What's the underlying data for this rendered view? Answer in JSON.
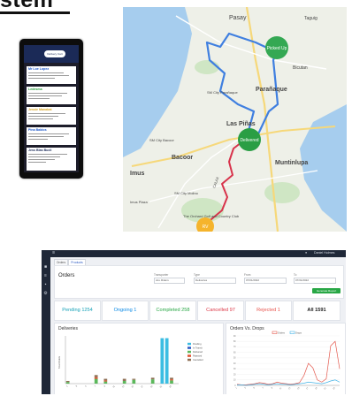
{
  "title": "stem",
  "phone": {
    "header_button": "Delivery Cart",
    "cards": [
      {
        "title": "Mr Loe Lopez"
      },
      {
        "title": "Ledesma"
      },
      {
        "title": "Jessie Manabat"
      },
      {
        "title": "Pina Baldos"
      },
      {
        "title": "Jess Blas Bucli"
      }
    ]
  },
  "map": {
    "places": {
      "pasay": "Pasay",
      "paranaque": "Parañaque",
      "las_pinas": "Las Piñas",
      "bacoor": "Bacoor",
      "muntinlupa": "Muntinlupa",
      "imus": "Imus",
      "sm_mall": "SM City Bacoor",
      "city_mall": "SM City Parañaque",
      "sm_city": "SM City Molino",
      "imus_plaza": "Imus Plaza",
      "orchard": "The Orchard Golf and Country Club",
      "paliparan": "CALAX",
      "bicutan": "Bicutan",
      "taguig": "Taguig"
    },
    "markers": {
      "picked_up": "Picked Up",
      "delivered": "Delivered",
      "origin": "RV"
    },
    "colors": {
      "route_blue": "#3f7fe0",
      "route_red": "#d8334b",
      "picked": "#34a853",
      "origin": "#f5b42c",
      "water": "#9fc8ec",
      "land": "#eef0e8"
    }
  },
  "dashboard": {
    "topbar_user": "Daniel Holmes",
    "tabs": [
      "Orders",
      "Products"
    ],
    "panel_title": "Orders",
    "filters": [
      {
        "label": "Transporter",
        "value": "ALL Riders"
      },
      {
        "label": "Type",
        "value": "Deliveries"
      },
      {
        "label": "From",
        "value": "07/01/2022"
      },
      {
        "label": "To",
        "value": "07/31/2022"
      }
    ],
    "generate_button": "Generate Report",
    "stats": [
      {
        "label": "Pending 1254",
        "color": "#17a2b8"
      },
      {
        "label": "Ongoing 1",
        "color": "#0d8be6"
      },
      {
        "label": "Completed 258",
        "color": "#28a745"
      },
      {
        "label": "Cancelled 97",
        "color": "#dc3545"
      },
      {
        "label": "Rejected 1",
        "color": "#e8554e"
      },
      {
        "label": "All 1591",
        "color": "#222222"
      }
    ],
    "deliveries_title": "Deliveries",
    "deliveries_legend": [
      {
        "name": "Pending",
        "color": "#3bbde2"
      },
      {
        "name": "In Transit",
        "color": "#2b59c3"
      },
      {
        "name": "Delivered",
        "color": "#5cb85c"
      },
      {
        "name": "Rejected",
        "color": "#e0522f"
      },
      {
        "name": "Cancelled",
        "color": "#8e6e53"
      }
    ],
    "orders_title": "Orders Vs. Drops",
    "orders_legend": [
      {
        "name": "Orders",
        "color": "#e45a4f"
      },
      {
        "name": "Drops",
        "color": "#45b3e6"
      }
    ],
    "ylabel": "Total Orders"
  },
  "chart_data": [
    {
      "type": "bar",
      "title": "Deliveries",
      "ylabel": "Total Orders",
      "stacked": true,
      "categories": [
        "1",
        "2",
        "3",
        "4",
        "5",
        "6",
        "7",
        "8",
        "9",
        "10",
        "11",
        "12",
        "13",
        "14",
        "15",
        "16",
        "17",
        "18",
        "19",
        "20",
        "21",
        "22",
        "23",
        "24"
      ],
      "series": [
        {
          "name": "Pending",
          "values": [
            0,
            0,
            0,
            0,
            0,
            0,
            0,
            0,
            0,
            0,
            0,
            0,
            0,
            0,
            0,
            0,
            0,
            0,
            0,
            0,
            85,
            85,
            0,
            0
          ]
        },
        {
          "name": "In Transit",
          "values": [
            0,
            0,
            0,
            0,
            0,
            0,
            0,
            0,
            0,
            0,
            0,
            0,
            0,
            0,
            0,
            0,
            0,
            0,
            0,
            0,
            0,
            0,
            0,
            0
          ]
        },
        {
          "name": "Delivered",
          "values": [
            3,
            0,
            0,
            0,
            0,
            0,
            9,
            0,
            4,
            0,
            0,
            0,
            5,
            0,
            7,
            0,
            0,
            0,
            8,
            0,
            0,
            0,
            6,
            0
          ]
        },
        {
          "name": "Rejected",
          "values": [
            0,
            0,
            0,
            0,
            0,
            0,
            3,
            0,
            2,
            0,
            0,
            0,
            0,
            0,
            0,
            0,
            0,
            0,
            0,
            0,
            0,
            0,
            2,
            0
          ]
        },
        {
          "name": "Cancelled",
          "values": [
            2,
            0,
            0,
            0,
            0,
            0,
            4,
            0,
            3,
            0,
            0,
            0,
            4,
            0,
            2,
            0,
            0,
            0,
            3,
            0,
            0,
            0,
            3,
            0
          ]
        }
      ],
      "legend": "top-right"
    },
    {
      "type": "line",
      "title": "Orders Vs. Drops",
      "x": [
        "1",
        "2",
        "3",
        "4",
        "5",
        "6",
        "7",
        "8",
        "9",
        "10",
        "11",
        "12",
        "13",
        "14",
        "15",
        "16",
        "17",
        "18",
        "19",
        "20",
        "21",
        "22",
        "23",
        "24"
      ],
      "series": [
        {
          "name": "Orders",
          "values": [
            2,
            1,
            1,
            2,
            3,
            5,
            4,
            2,
            3,
            6,
            4,
            3,
            2,
            3,
            5,
            18,
            40,
            32,
            10,
            6,
            12,
            72,
            80,
            30
          ]
        },
        {
          "name": "Drops",
          "values": [
            1,
            1,
            0,
            1,
            2,
            3,
            2,
            1,
            2,
            3,
            2,
            2,
            1,
            2,
            3,
            4,
            6,
            5,
            4,
            3,
            5,
            8,
            10,
            6
          ]
        }
      ],
      "legend": "top-center",
      "ylim": [
        0,
        90
      ]
    }
  ]
}
